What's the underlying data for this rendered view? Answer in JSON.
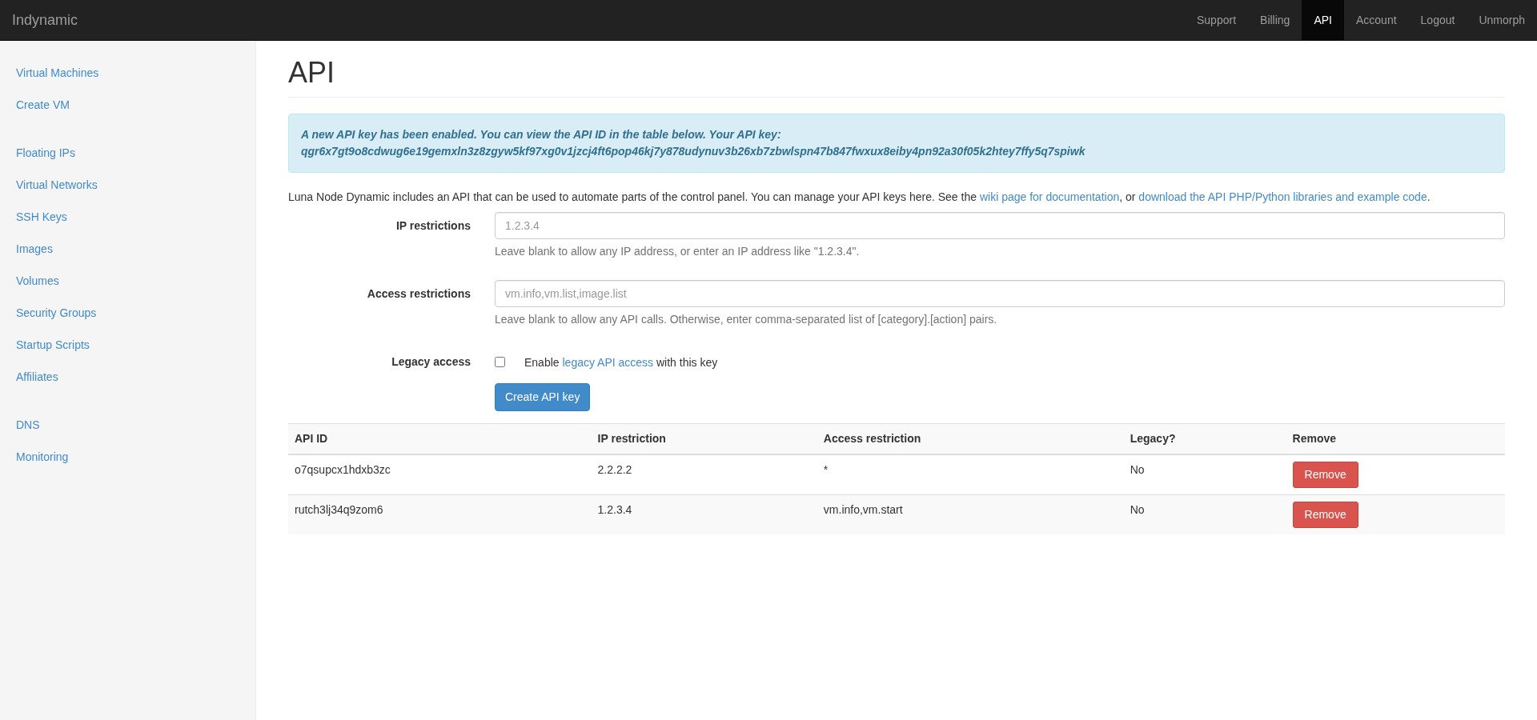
{
  "navbar": {
    "brand": "Indynamic",
    "items": [
      {
        "label": "Support",
        "selected": false
      },
      {
        "label": "Billing",
        "selected": false
      },
      {
        "label": "API",
        "selected": true
      },
      {
        "label": "Account",
        "selected": false
      },
      {
        "label": "Logout",
        "selected": false
      },
      {
        "label": "Unmorph",
        "selected": false
      }
    ]
  },
  "sidebar": {
    "groups": [
      [
        "Virtual Machines",
        "Create VM"
      ],
      [
        "Floating IPs",
        "Virtual Networks",
        "SSH Keys",
        "Images",
        "Volumes",
        "Security Groups",
        "Startup Scripts",
        "Affiliates"
      ],
      [
        "DNS",
        "Monitoring"
      ]
    ]
  },
  "page_title": "API",
  "alert": {
    "message": "A new API key has been enabled. You can view the API ID in the table below. Your API key:",
    "api_key": "qgr6x7gt9o8cdwug6e19gemxln3z8zgyw5kf97xg0v1jzcj4ft6pop46kj7y878udynuv3b26xb7zbwlspn47b847fwxux8eiby4pn92a30f05k2htey7ffy5q7spiwk"
  },
  "description": [
    {
      "kind": "text",
      "text": "Luna Node Dynamic includes an API that can be used to automate parts of the control panel. You can manage your API keys here. See the "
    },
    {
      "kind": "link",
      "text": "wiki page for documentation"
    },
    {
      "kind": "text",
      "text": ", or "
    },
    {
      "kind": "link",
      "text": "download the API PHP/Python libraries and example code"
    },
    {
      "kind": "text",
      "text": "."
    }
  ],
  "form": {
    "fields": [
      {
        "kind": "input",
        "label": "IP restrictions",
        "placeholder": "1.2.3.4",
        "help": "Leave blank to allow any IP address, or enter an IP address like \"1.2.3.4\"."
      },
      {
        "kind": "input",
        "label": "Access restrictions",
        "placeholder": "vm.info,vm.list,image.list",
        "help": "Leave blank to allow any API calls. Otherwise, enter comma-separated list of [category].[action] pairs."
      },
      {
        "kind": "checkbox",
        "label": "Legacy access",
        "checked": false,
        "text_before": "Enable ",
        "link": "legacy API access",
        "text_after": " with this key"
      }
    ],
    "submit": "Create API key"
  },
  "table": {
    "columns": [
      "API ID",
      "IP restriction",
      "Access restriction",
      "Legacy?",
      "Remove"
    ],
    "rows": [
      {
        "api_id": "o7qsupcx1hdxb3zc",
        "ip": "2.2.2.2",
        "access": "*",
        "legacy": "No",
        "remove": "Remove"
      },
      {
        "api_id": "rutch3lj34q9zom6",
        "ip": "1.2.3.4",
        "access": "vm.info,vm.start",
        "legacy": "No",
        "remove": "Remove"
      }
    ]
  }
}
